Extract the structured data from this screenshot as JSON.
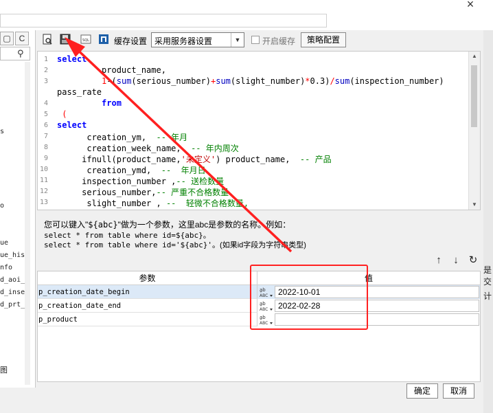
{
  "window": {
    "close_glyph": "×"
  },
  "left_panel": {
    "refresh_glyph": "C",
    "items": [
      "s",
      "o",
      "ue",
      "ue_his",
      "nfo",
      "d_aoi_",
      "d_inse",
      "d_prt_",
      "图"
    ]
  },
  "toolbar": {
    "cache_label": "缓存设置",
    "cache_select_value": "采用服务器设置",
    "enable_cache_label": "开启缓存",
    "strategy_button": "策略配置",
    "icons": [
      "preview-icon",
      "save-sql-icon",
      "sql-icon",
      "database-icon"
    ]
  },
  "editor": {
    "line_numbers": [
      "1",
      "2",
      "3",
      "",
      "4",
      "5",
      "6",
      "7",
      "8",
      "9",
      "10",
      "11",
      "12",
      "13"
    ]
  },
  "help": {
    "line1_a": "您可以键入\"",
    "line1_b": "${abc}",
    "line1_c": "\"做为一个参数，这里abc是参数的名称。例如：",
    "line2": "select * from table where id=${abc}。",
    "line3_a": "select * from table where id='${abc}'",
    "line3_b": "。(如果id字段为字符串类型)"
  },
  "param_table": {
    "col_param": "参数",
    "col_value": "值",
    "rows": [
      {
        "name": "p_creation_date_begin",
        "value": "2022-10-01"
      },
      {
        "name": "p_creation_date_end",
        "value": "2022-02-28"
      },
      {
        "name": "p_product",
        "value": ""
      }
    ]
  },
  "footer": {
    "ok": "确定",
    "cancel": "取消"
  },
  "right_edge": {
    "t1": "是交",
    "t2": "计"
  },
  "colors": {
    "annotation": "#ff2020",
    "keyword": "#0000ff",
    "comment": "#008000",
    "string": "#c00000"
  }
}
